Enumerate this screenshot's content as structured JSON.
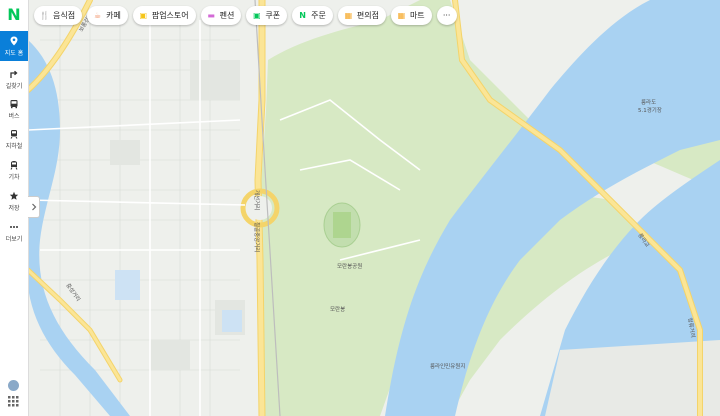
{
  "sidebar": {
    "logo": "N",
    "items": [
      {
        "label": "지도 홈",
        "icon": "map-pin-icon",
        "active": true
      },
      {
        "label": "길찾기",
        "icon": "directions-icon"
      },
      {
        "label": "버스",
        "icon": "bus-icon"
      },
      {
        "label": "지하철",
        "icon": "subway-icon"
      },
      {
        "label": "기차",
        "icon": "train-icon"
      },
      {
        "label": "저장",
        "icon": "star-icon"
      },
      {
        "label": "더보기",
        "icon": "more-dots-icon"
      }
    ]
  },
  "chips": [
    {
      "label": "음식점",
      "icon": "fork-knife-icon",
      "color": "#f5a623"
    },
    {
      "label": "카페",
      "icon": "coffee-icon",
      "color": "#f08a5d"
    },
    {
      "label": "팝업스토어",
      "icon": "popup-store-icon",
      "color": "#f5c518"
    },
    {
      "label": "펜션",
      "icon": "bed-icon",
      "color": "#d36ad6"
    },
    {
      "label": "쿠폰",
      "icon": "coupon-icon",
      "color": "#03c75a"
    },
    {
      "label": "주문",
      "icon": "naver-order-icon",
      "color": "#03c75a"
    },
    {
      "label": "편의점",
      "icon": "convenience-store-icon",
      "color": "#f5a623"
    },
    {
      "label": "마트",
      "icon": "mart-icon",
      "color": "#f5a623"
    }
  ],
  "chip_glyphs": {
    "fork-knife-icon": "🍴",
    "coffee-icon": "☕",
    "popup-store-icon": "▣",
    "bed-icon": "▬",
    "coupon-icon": "▣",
    "naver-order-icon": "N",
    "convenience-store-icon": "▦",
    "mart-icon": "▦"
  },
  "more_label": "···",
  "map_labels": {
    "park": "모란봉공원",
    "hill": "모란봉",
    "stadium": "릉라도\n5.1경기장",
    "amusement": "릉라인민유원지",
    "road_vertical": "개선거리",
    "road_vertical2": "칠골중앙거리",
    "road_left": "중성거리",
    "road_top": "보통강거리",
    "bridge": "릉라교",
    "road_right": "청류거리"
  },
  "colors": {
    "water": "#a9d2f2",
    "park": "#d9ebc6",
    "road": "#fbe596",
    "accent": "#0a7fd9",
    "brand": "#03c75a"
  }
}
